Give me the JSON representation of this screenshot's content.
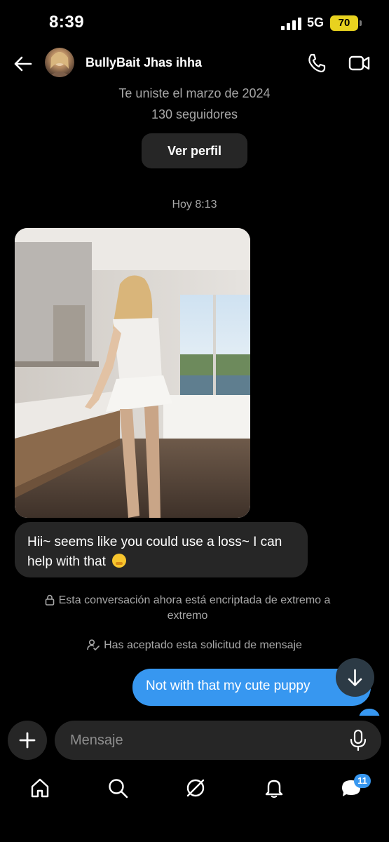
{
  "status_bar": {
    "time": "8:39",
    "network": "5G",
    "battery": "70",
    "battery_color": "#e8d21f"
  },
  "header": {
    "contact_name": "BullyBait Jhas ihha",
    "back_icon": "arrow-left-icon",
    "call_icon": "phone-icon",
    "video_icon": "video-camera-icon"
  },
  "profile_info": {
    "joined": "Te uniste el marzo de 2024",
    "followers": "130 seguidores",
    "view_profile_label": "Ver perfil"
  },
  "conversation": {
    "timestamp": "Hoy 8:13",
    "incoming_message": "Hii~ seems like you could use a loss~ I can help with that",
    "incoming_emoji": "🫢",
    "encryption_notice": "Esta conversación ahora está encriptada de extremo a extremo",
    "accepted_notice": "Has aceptado esta solicitud de mensaje",
    "outgoing_message": "Not with that my cute puppy"
  },
  "composer": {
    "placeholder": "Mensaje",
    "plus_icon": "plus-icon",
    "mic_icon": "microphone-icon"
  },
  "tabbar": {
    "messages_badge": "11"
  },
  "colors": {
    "background": "#000000",
    "bubble_incoming": "#262626",
    "bubble_outgoing": "#3797f0",
    "secondary_text": "#a8a8a8"
  }
}
